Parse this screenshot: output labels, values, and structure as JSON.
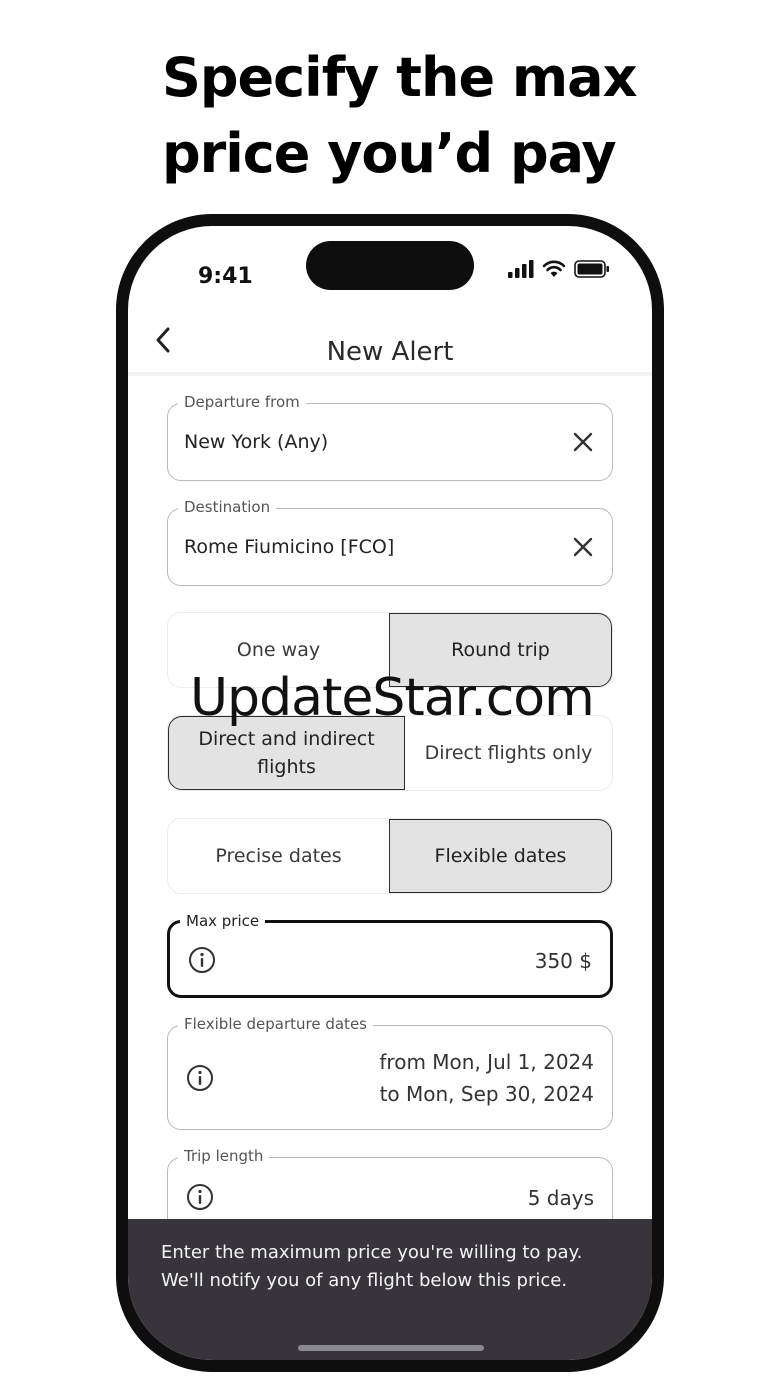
{
  "headline": "Specify the max price you’d pay",
  "status_bar": {
    "time": "9:41"
  },
  "nav": {
    "title": "New Alert"
  },
  "departure": {
    "label": "Departure from",
    "value": "New York (Any)"
  },
  "destination": {
    "label": "Destination",
    "value": "Rome Fiumicino [FCO]"
  },
  "trip_type": {
    "options": [
      "One way",
      "Round trip"
    ],
    "selected": "Round trip"
  },
  "flight_type": {
    "options": [
      "Direct and indirect flights",
      "Direct flights only"
    ],
    "selected": "Direct and indirect flights"
  },
  "date_type": {
    "options": [
      "Precise dates",
      "Flexible dates"
    ],
    "selected": "Flexible dates"
  },
  "max_price": {
    "label": "Max price",
    "value": "350 $"
  },
  "flexible_dates": {
    "label": "Flexible departure dates",
    "from": "from Mon, Jul 1, 2024",
    "to": "to Mon, Sep 30, 2024"
  },
  "trip_length": {
    "label": "Trip length",
    "value": "5 days"
  },
  "tooltip": {
    "text": "Enter the maximum price you're willing to pay. We'll notify you of any flight below this price."
  },
  "watermark": "UpdateStar.com",
  "colors": {
    "selected_bg": "#e3e3e3",
    "tooltip_bg": "#37353b",
    "phone_frame": "#0e0e0e"
  }
}
